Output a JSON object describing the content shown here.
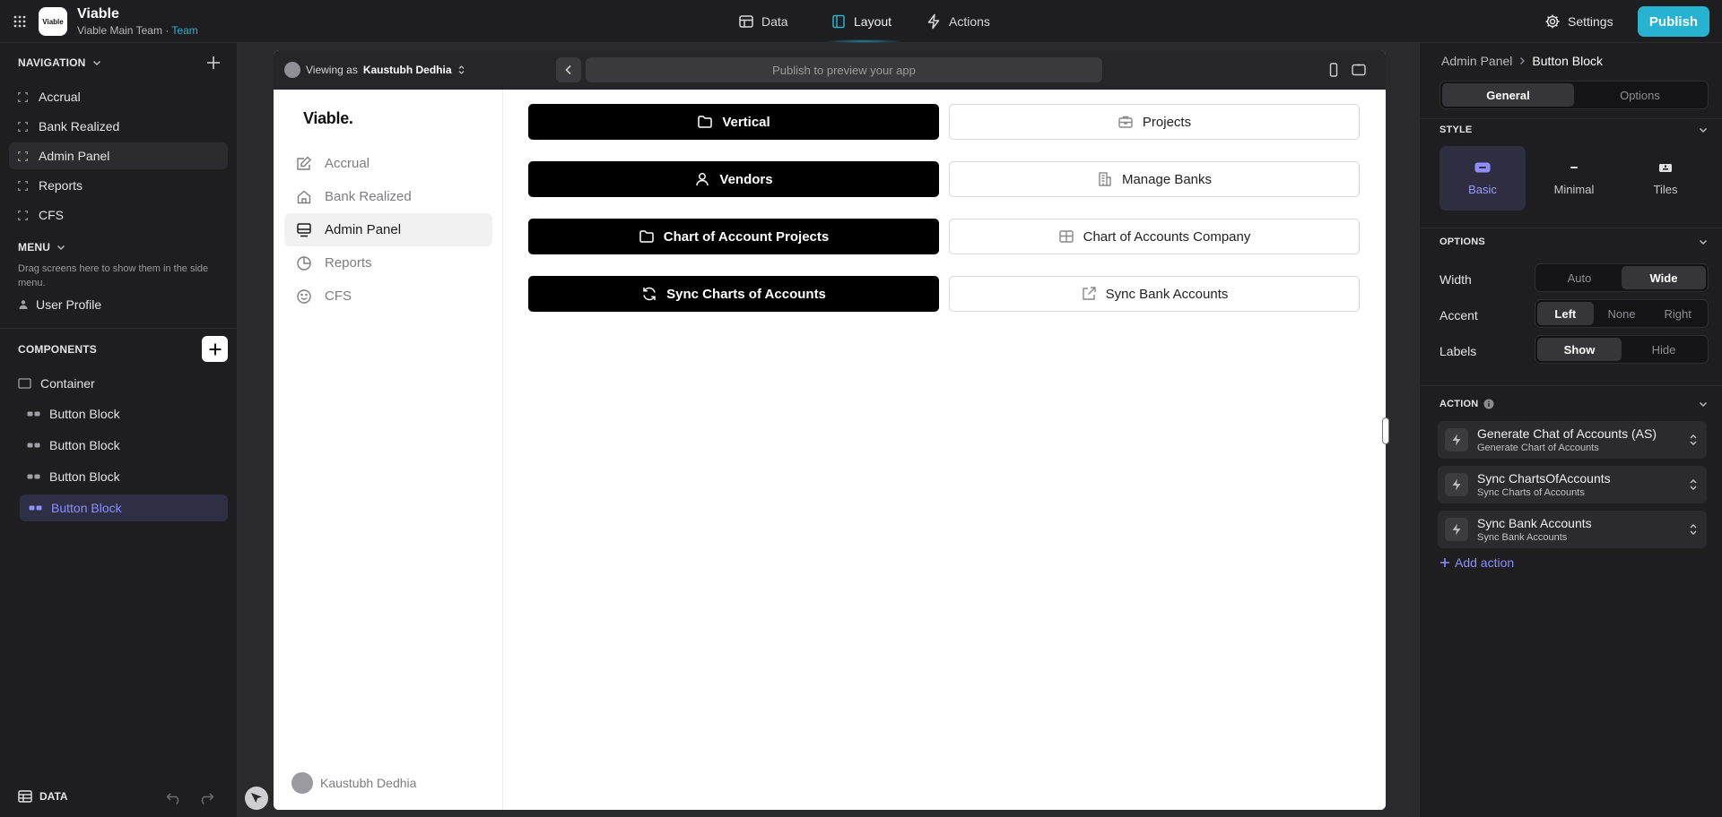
{
  "topbar": {
    "logo_text": "Viable",
    "app_name": "Viable",
    "team_name": "Viable Main Team",
    "team_sep": " · ",
    "team_tag": "Team",
    "tabs": [
      {
        "label": "Data",
        "icon": "table-icon"
      },
      {
        "label": "Layout",
        "icon": "book-icon",
        "active": true
      },
      {
        "label": "Actions",
        "icon": "bolt-icon"
      }
    ],
    "settings_label": "Settings",
    "publish_label": "Publish",
    "accent_color": "#26b3d1"
  },
  "left": {
    "navigation_title": "NAVIGATION",
    "nav_items": [
      {
        "label": "Accrual"
      },
      {
        "label": "Bank Realized"
      },
      {
        "label": "Admin Panel",
        "active": true
      },
      {
        "label": "Reports"
      },
      {
        "label": "CFS"
      }
    ],
    "menu_title": "MENU",
    "menu_hint": "Drag screens here to show them in the side menu.",
    "user_profile": "User Profile",
    "components_title": "COMPONENTS",
    "components": [
      {
        "label": "Container",
        "icon": "container-icon"
      },
      {
        "label": "Button Block",
        "icon": "button-block-icon"
      },
      {
        "label": "Button Block",
        "icon": "button-block-icon"
      },
      {
        "label": "Button Block",
        "icon": "button-block-icon"
      },
      {
        "label": "Button Block",
        "icon": "button-block-icon",
        "selected": true
      }
    ],
    "data_label": "DATA"
  },
  "preview": {
    "viewing_prefix": "Viewing as",
    "viewing_user": "Kaustubh Dedhia",
    "url_placeholder": "Publish to preview your app",
    "app": {
      "brand": "Viable.",
      "nav": [
        {
          "label": "Accrual",
          "icon": "edit-icon"
        },
        {
          "label": "Bank Realized",
          "icon": "home-icon"
        },
        {
          "label": "Admin Panel",
          "icon": "monitor-icon",
          "active": true
        },
        {
          "label": "Reports",
          "icon": "pie-chart-icon"
        },
        {
          "label": "CFS",
          "icon": "smile-icon"
        }
      ],
      "footer_user": "Kaustubh Dedhia",
      "buttons": [
        {
          "label": "Vertical",
          "icon": "folder-icon",
          "style": "dark"
        },
        {
          "label": "Projects",
          "icon": "briefcase-icon",
          "style": "light"
        },
        {
          "label": "Vendors",
          "icon": "user-icon",
          "style": "dark"
        },
        {
          "label": "Manage Banks",
          "icon": "building-icon",
          "style": "light"
        },
        {
          "label": "Chart of Account Projects",
          "icon": "folder-icon",
          "style": "dark"
        },
        {
          "label": "Chart of Accounts Company",
          "icon": "layout-icon",
          "style": "light"
        },
        {
          "label": "Sync Charts of Accounts",
          "icon": "refresh-icon",
          "style": "dark"
        },
        {
          "label": "Sync Bank Accounts",
          "icon": "external-link-icon",
          "style": "light"
        }
      ]
    }
  },
  "right": {
    "breadcrumb_parent": "Admin Panel",
    "breadcrumb_current": "Button Block",
    "tabs": [
      {
        "label": "General",
        "active": true
      },
      {
        "label": "Options"
      }
    ],
    "style_title": "STYLE",
    "styles": [
      {
        "label": "Basic",
        "active": true
      },
      {
        "label": "Minimal"
      },
      {
        "label": "Tiles"
      }
    ],
    "options_title": "OPTIONS",
    "width_label": "Width",
    "width_options": [
      {
        "label": "Auto"
      },
      {
        "label": "Wide",
        "active": true
      }
    ],
    "accent_label": "Accent",
    "accent_options": [
      {
        "label": "Left",
        "active": true
      },
      {
        "label": "None"
      },
      {
        "label": "Right"
      }
    ],
    "labels_label": "Labels",
    "labels_options": [
      {
        "label": "Show",
        "active": true
      },
      {
        "label": "Hide"
      }
    ],
    "action_title": "ACTION",
    "actions": [
      {
        "title": "Generate Chat of Accounts (AS)",
        "subtitle": "Generate Chart of Accounts"
      },
      {
        "title": "Sync ChartsOfAccounts",
        "subtitle": "Sync Charts of Accounts"
      },
      {
        "title": "Sync Bank Accounts",
        "subtitle": "Sync Bank Accounts"
      }
    ],
    "add_action_label": "Add action",
    "selected_color": "#8d8dff"
  }
}
